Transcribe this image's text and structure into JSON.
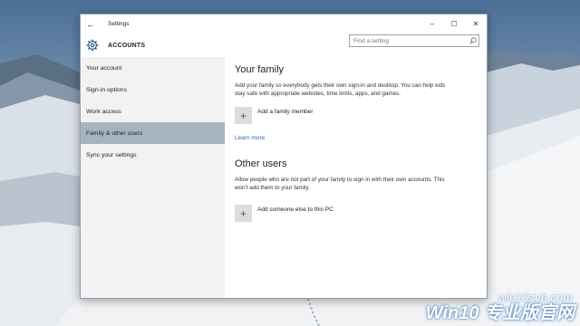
{
  "window": {
    "title": "Settings",
    "controls": {
      "back": "←",
      "minimize": "–",
      "maximize": "☐",
      "close": "✕"
    }
  },
  "header": {
    "title": "ACCOUNTS",
    "icon": "gear-icon",
    "search_placeholder": "Find a setting"
  },
  "sidebar": {
    "items": [
      {
        "label": "Your account"
      },
      {
        "label": "Sign-in options"
      },
      {
        "label": "Work access"
      },
      {
        "label": "Family & other users"
      },
      {
        "label": "Sync your settings"
      }
    ],
    "selected": "Family & other users",
    "selected_color": "#a6b4c2"
  },
  "main": {
    "family": {
      "heading": "Your family",
      "description": "Add your family so everybody gets their own sign-in and desktop. You can help kids stay safe with appropriate websites, time limits, apps, and games.",
      "add_label": "Add a family member",
      "learn_more": "Learn more"
    },
    "others": {
      "heading": "Other users",
      "description": "Allow people who are not part of your family to sign in with their own accounts. This won't add them to your family.",
      "add_label": "Add someone else to this PC"
    },
    "link_color": "#2a6cb5"
  },
  "watermark": {
    "url": "win10zyb.com",
    "brand": "Win10 专业版官网"
  }
}
